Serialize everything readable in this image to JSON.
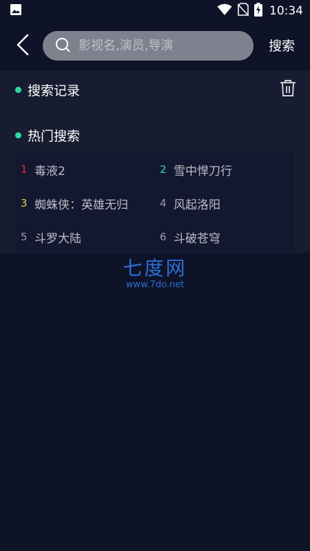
{
  "status_bar": {
    "time": "10:34",
    "icons": [
      "image-icon",
      "wifi-icon",
      "no-sim-icon",
      "battery-charging-icon"
    ]
  },
  "header": {
    "back_icon": "chevron-left-icon",
    "search_placeholder": "影视名,演员,导演",
    "search_value": "",
    "search_button_label": "搜索"
  },
  "history": {
    "title": "搜索记录",
    "delete_icon": "trash-icon"
  },
  "hot": {
    "title": "热门搜索",
    "items": [
      {
        "rank": "1",
        "text": "毒液2"
      },
      {
        "rank": "2",
        "text": "雪中悍刀行"
      },
      {
        "rank": "3",
        "text": "蜘蛛侠：英雄无归"
      },
      {
        "rank": "4",
        "text": "风起洛阳"
      },
      {
        "rank": "5",
        "text": "斗罗大陆"
      },
      {
        "rank": "6",
        "text": "斗破苍穹"
      }
    ]
  },
  "watermark": {
    "main": "七度网",
    "sub": "www.7do.net"
  },
  "colors": {
    "background": "#0e1328",
    "panel": "#171c30",
    "accent_dot": "#2fd8a2",
    "rank_1": "#e02f37",
    "rank_2": "#2fd8a2",
    "rank_3": "#e8d34a",
    "watermark": "#2c6fd4"
  }
}
